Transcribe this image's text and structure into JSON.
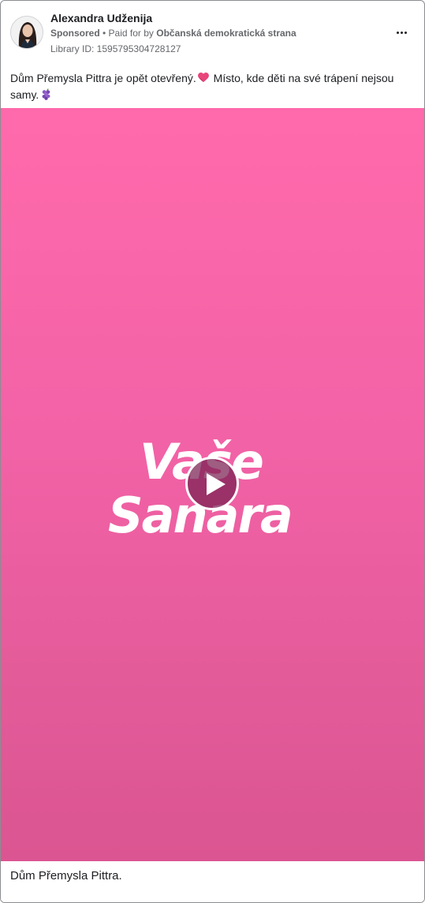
{
  "post": {
    "author": "Alexandra Udženija",
    "sponsored_label": "Sponsored",
    "bullet": " • ",
    "paid_for_prefix": "Paid for by ",
    "payer": "Občanská demokratická strana",
    "library_id": "Library ID: 1595795304728127",
    "more_icon": "more-horizontal-icon"
  },
  "body": {
    "text_part1": "Dům Přemysla Pittra je opět otevřený.",
    "text_part2": " Místo, kde děti na své trápení nejsou samy.",
    "heart_emoji_icon": "heart-emoji-icon",
    "grapes_emoji_icon": "grapes-emoji-icon"
  },
  "video": {
    "logo_text_line1": "Vaše",
    "logo_text_line2": "Sanara",
    "background_top": "#ff6aac",
    "background_bottom": "#db5592",
    "play_icon": "play-icon"
  },
  "footer": {
    "caption": "Dům Přemysla Pittra."
  }
}
